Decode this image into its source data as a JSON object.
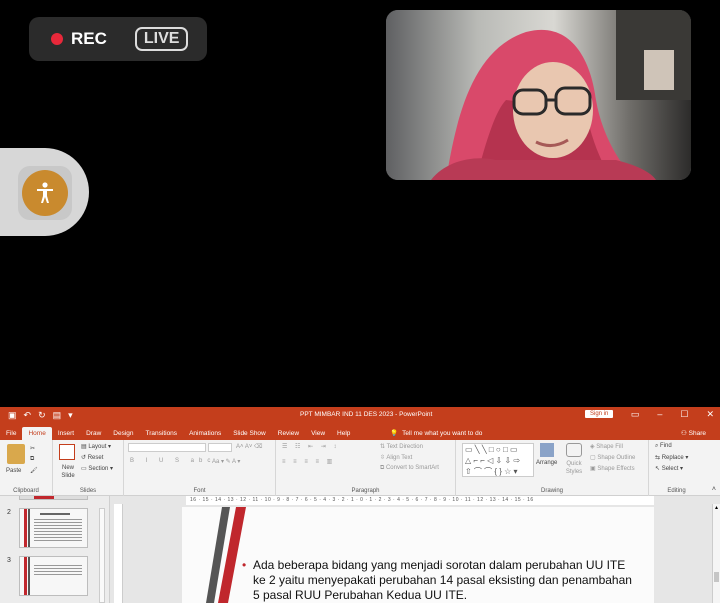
{
  "recording": {
    "rec_label": "REC",
    "live_label": "LIVE"
  },
  "powerpoint": {
    "window_title": "PPT MIMBAR IND 11 DES 2023  -  PowerPoint",
    "sign_in": "Sign in",
    "tabs": [
      "File",
      "Home",
      "Insert",
      "Draw",
      "Design",
      "Transitions",
      "Animations",
      "Slide Show",
      "Review",
      "View",
      "Help"
    ],
    "active_tab": "Home",
    "tell_me": "Tell me what you want to do",
    "share": "Share",
    "ribbon": {
      "clipboard": {
        "label": "Clipboard",
        "paste": "Paste"
      },
      "slides": {
        "label": "Slides",
        "new_slide": "New Slide",
        "layout": "Layout",
        "reset": "Reset",
        "section": "Section"
      },
      "font": {
        "label": "Font"
      },
      "paragraph": {
        "label": "Paragraph",
        "text_direction": "Text Direction",
        "align_text": "Align Text",
        "convert_smartart": "Convert to SmartArt"
      },
      "drawing": {
        "label": "Drawing",
        "arrange": "Arrange",
        "quick_styles": "Quick Styles",
        "shape_fill": "Shape Fill",
        "shape_outline": "Shape Outline",
        "shape_effects": "Shape Effects"
      },
      "editing": {
        "label": "Editing",
        "find": "Find",
        "replace": "Replace",
        "select": "Select"
      }
    },
    "thumbnails": [
      {
        "number": "2"
      },
      {
        "number": "3"
      }
    ],
    "ruler_text": "16 · 15 · 14 · 13 · 12 · 11 · 10 · 9 · 8 · 7 · 6 · 5 · 4 · 3 · 2 · 1 · 0 · 1 · 2 · 3 · 4 · 5 · 6 · 7 · 8 · 9 · 10 · 11 · 12 · 13 · 14 · 15 · 16",
    "slide_text": "Ada beberapa bidang yang menjadi sorotan dalam perubahan UU ITE ke 2 yaitu menyepakati perubahan 14 pasal eksisting dan penambahan 5 pasal RUU Perubahan Kedua UU ITE."
  },
  "colors": {
    "ppt_accent": "#c43e1c",
    "rec_dot": "#e8283a",
    "slide_stripe_red": "#c0272d",
    "slide_stripe_gray": "#555555"
  }
}
